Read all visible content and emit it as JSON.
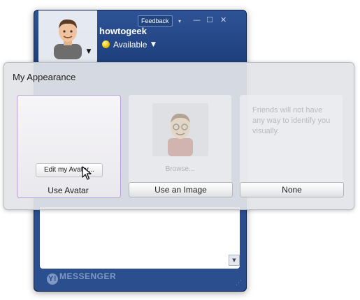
{
  "messenger": {
    "feedback_label": "Feedback",
    "username": "howtogeek",
    "status": "Available",
    "footer_logo": "MESSENGER",
    "footer_badge": "Y!",
    "window_controls": {
      "menu": "▾",
      "minimize": "—",
      "maximize": "☐",
      "close": "✕"
    }
  },
  "appearance": {
    "title": "My Appearance",
    "edit_avatar_label": "Edit my Avatar...",
    "browse_label": "Browse...",
    "none_description": "Friends will not have any way to identify you visually.",
    "options": {
      "avatar": "Use Avatar",
      "image": "Use an Image",
      "none": "None"
    },
    "selected": "avatar"
  },
  "colors": {
    "window_blue": "#2a4e8e",
    "selection_border": "#b9a0d8",
    "status_yellow": "#f3cf20"
  },
  "icons": [
    "avatar",
    "dropdown-chevron",
    "status-indicator",
    "pointer-cursor",
    "resize-grip"
  ]
}
